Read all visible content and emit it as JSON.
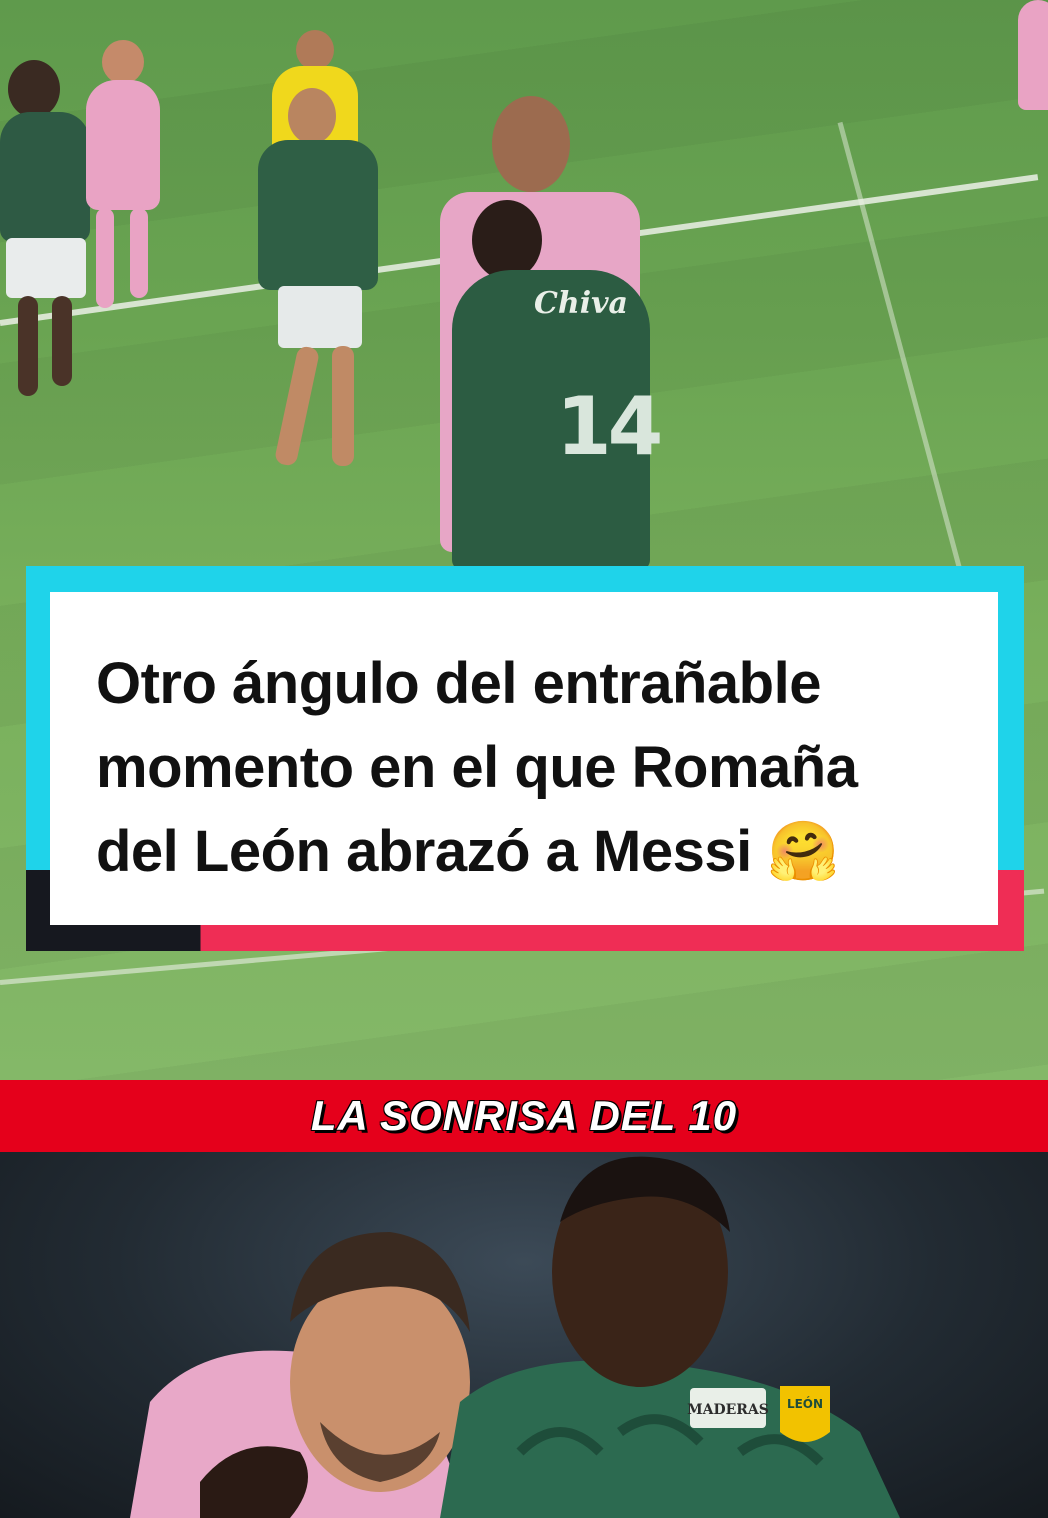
{
  "caption": {
    "line1": "Otro ángulo del entrañable",
    "line2": "momento en el que Romaña",
    "line3": "del León abrazó a Messi 🤗"
  },
  "banner": {
    "label": "LA SONRISA DEL 10"
  },
  "jersey": {
    "number": "14",
    "sponsor": "Chiva",
    "sponsor_bottom": "MADERAS",
    "crest": "LEÓN"
  },
  "colors": {
    "card_frame_top": "#1fd3ea",
    "card_frame_bottom_right": "#ef2d55",
    "card_frame_bottom_left": "#16181f",
    "banner": "#e5001b",
    "leon_green": "#2f5f45",
    "inter_pink": "#e9a3c4"
  }
}
